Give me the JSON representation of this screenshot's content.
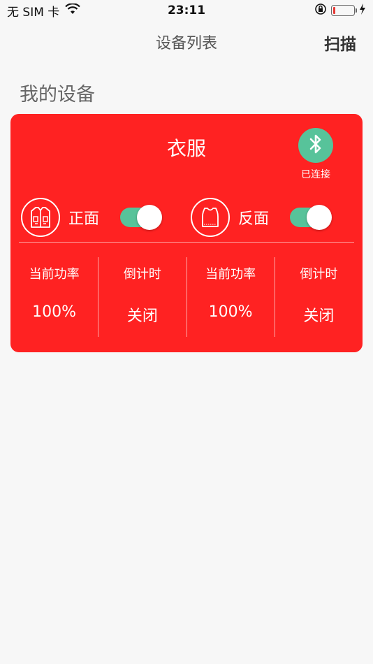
{
  "status_bar": {
    "carrier": "无 SIM 卡",
    "time": "23:11",
    "wifi_icon": "wifi-icon",
    "battery_color": "#e53935"
  },
  "nav": {
    "title": "设备列表",
    "action": "扫描"
  },
  "section": {
    "title": "我的设备"
  },
  "device": {
    "name": "衣服",
    "bluetooth_status": "已连接",
    "card_color": "#ff2222",
    "accent_color": "#57c39a",
    "front": {
      "label": "正面",
      "icon": "vest-front-icon",
      "enabled": true
    },
    "back": {
      "label": "反面",
      "icon": "vest-back-icon",
      "enabled": true
    },
    "stats": [
      {
        "label": "当前功率",
        "value": "100%"
      },
      {
        "label": "倒计时",
        "value": "关闭"
      },
      {
        "label": "当前功率",
        "value": "100%"
      },
      {
        "label": "倒计时",
        "value": "关闭"
      }
    ]
  }
}
